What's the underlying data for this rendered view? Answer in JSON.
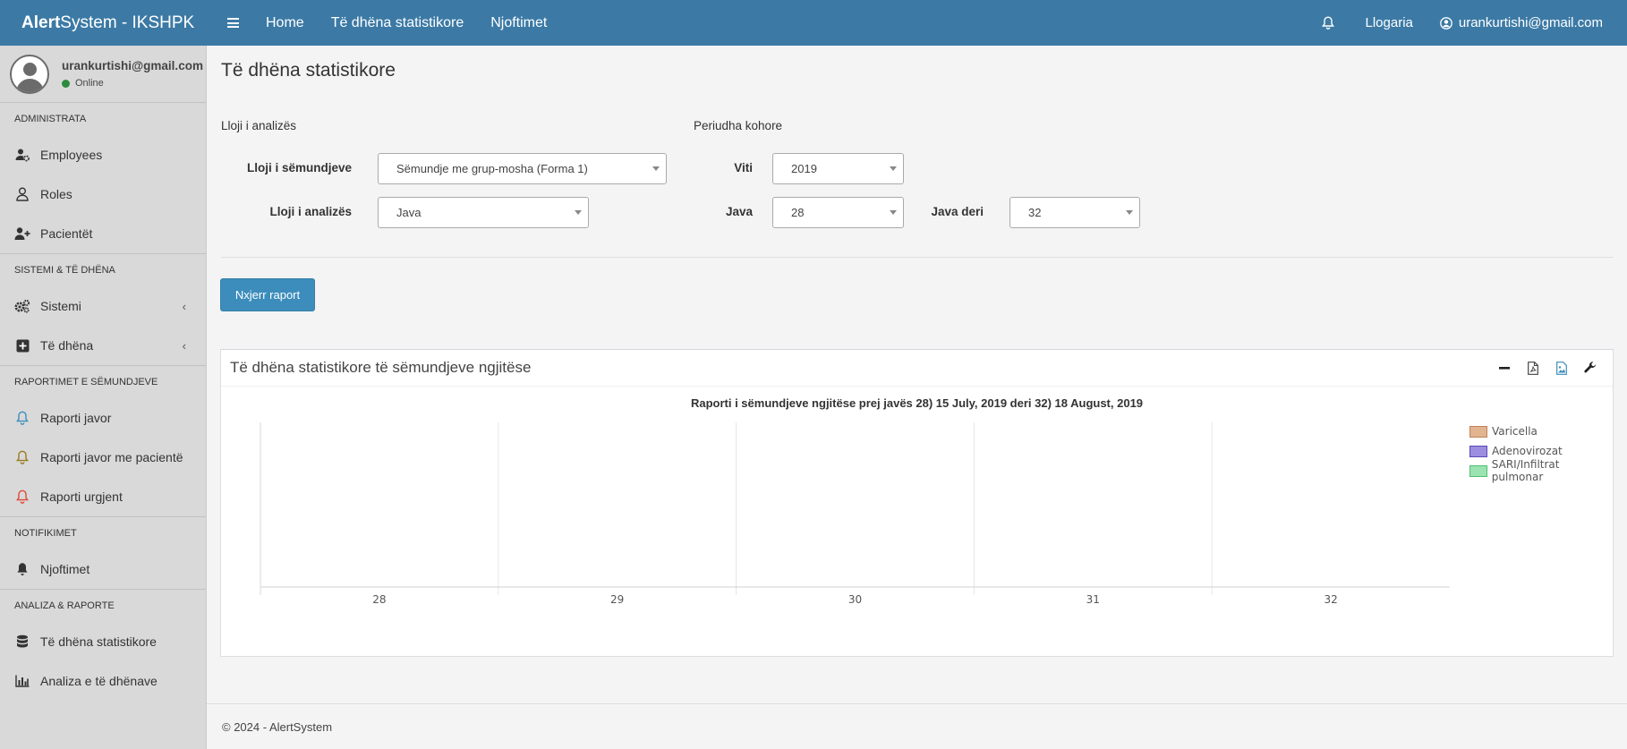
{
  "navbar": {
    "brand_bold": "Alert",
    "brand_rest": "System - IKSHPK",
    "links": [
      "Home",
      "Të dhëna statistikore",
      "Njoftimet"
    ],
    "account_label": "Llogaria",
    "user_email": "urankurtishi@gmail.com"
  },
  "sidebar": {
    "user_email": "urankurtishi@gmail.com",
    "status": "Online",
    "sections": [
      {
        "header": "ADMINISTRATA",
        "items": [
          {
            "label": "Employees",
            "icon": "users-cog-icon"
          },
          {
            "label": "Roles",
            "icon": "user-icon"
          },
          {
            "label": "Pacientët",
            "icon": "user-plus-icon"
          }
        ]
      },
      {
        "header": "SISTEMI & TË DHËNA",
        "items": [
          {
            "label": "Sistemi",
            "icon": "cogs-icon"
          },
          {
            "label": "Të dhëna",
            "icon": "plus-square-icon"
          }
        ]
      },
      {
        "header": "RAPORTIMET E SËMUNDJEVE",
        "items": [
          {
            "label": "Raporti javor",
            "icon": "bell-icon"
          },
          {
            "label": "Raporti javor me pacientë",
            "icon": "bell-icon"
          },
          {
            "label": "Raporti urgjent",
            "icon": "bell-icon"
          }
        ]
      },
      {
        "header": "NOTIFIKIMET",
        "items": [
          {
            "label": "Njoftimet",
            "icon": "bell-solid-icon"
          }
        ]
      },
      {
        "header": "ANALIZA & RAPORTE",
        "items": [
          {
            "label": "Të dhëna statistikore",
            "icon": "database-icon"
          },
          {
            "label": "Analiza e të dhënave",
            "icon": "bar-chart-icon"
          }
        ]
      }
    ]
  },
  "content": {
    "page_title": "Të dhëna statistikore",
    "analysis_group_label": "Lloji i analizës",
    "period_group_label": "Periudha kohore",
    "disease_type_label": "Lloji i sëmundjeve",
    "disease_type_value": "Sëmundje me grup-mosha (Forma 1)",
    "analysis_type_label": "Lloji i analizës",
    "analysis_type_value": "Java",
    "year_label": "Viti",
    "year_value": "2019",
    "week_label": "Java",
    "week_value": "28",
    "week_to_label": "Java deri",
    "week_to_value": "32",
    "report_button": "Nxjerr raport",
    "box_title": "Të dhëna statistikore të sëmundjeve ngjitëse"
  },
  "chart_data": {
    "type": "bar",
    "title": "Raporti i sëmundjeve ngjitëse prej javës 28) 15 July, 2019 deri 32) 18 August, 2019",
    "categories": [
      "28",
      "29",
      "30",
      "31",
      "32"
    ],
    "series": [
      {
        "name": "Varicella",
        "values": [
          0,
          0,
          0,
          0,
          0
        ],
        "color": "#e2b48f",
        "border": "#c0835a"
      },
      {
        "name": "Adenovirozat",
        "values": [
          0,
          0,
          0,
          0,
          0
        ],
        "color": "#9d8de0",
        "border": "#5a48b5"
      },
      {
        "name": "SARI/Infiltrat pulmonar",
        "values": [
          0,
          0,
          0,
          0,
          0
        ],
        "color": "#9be3b0",
        "border": "#4fbf72"
      }
    ],
    "legend_position": "right",
    "grid": true
  },
  "footer": {
    "text": "© 2024 - AlertSystem"
  }
}
